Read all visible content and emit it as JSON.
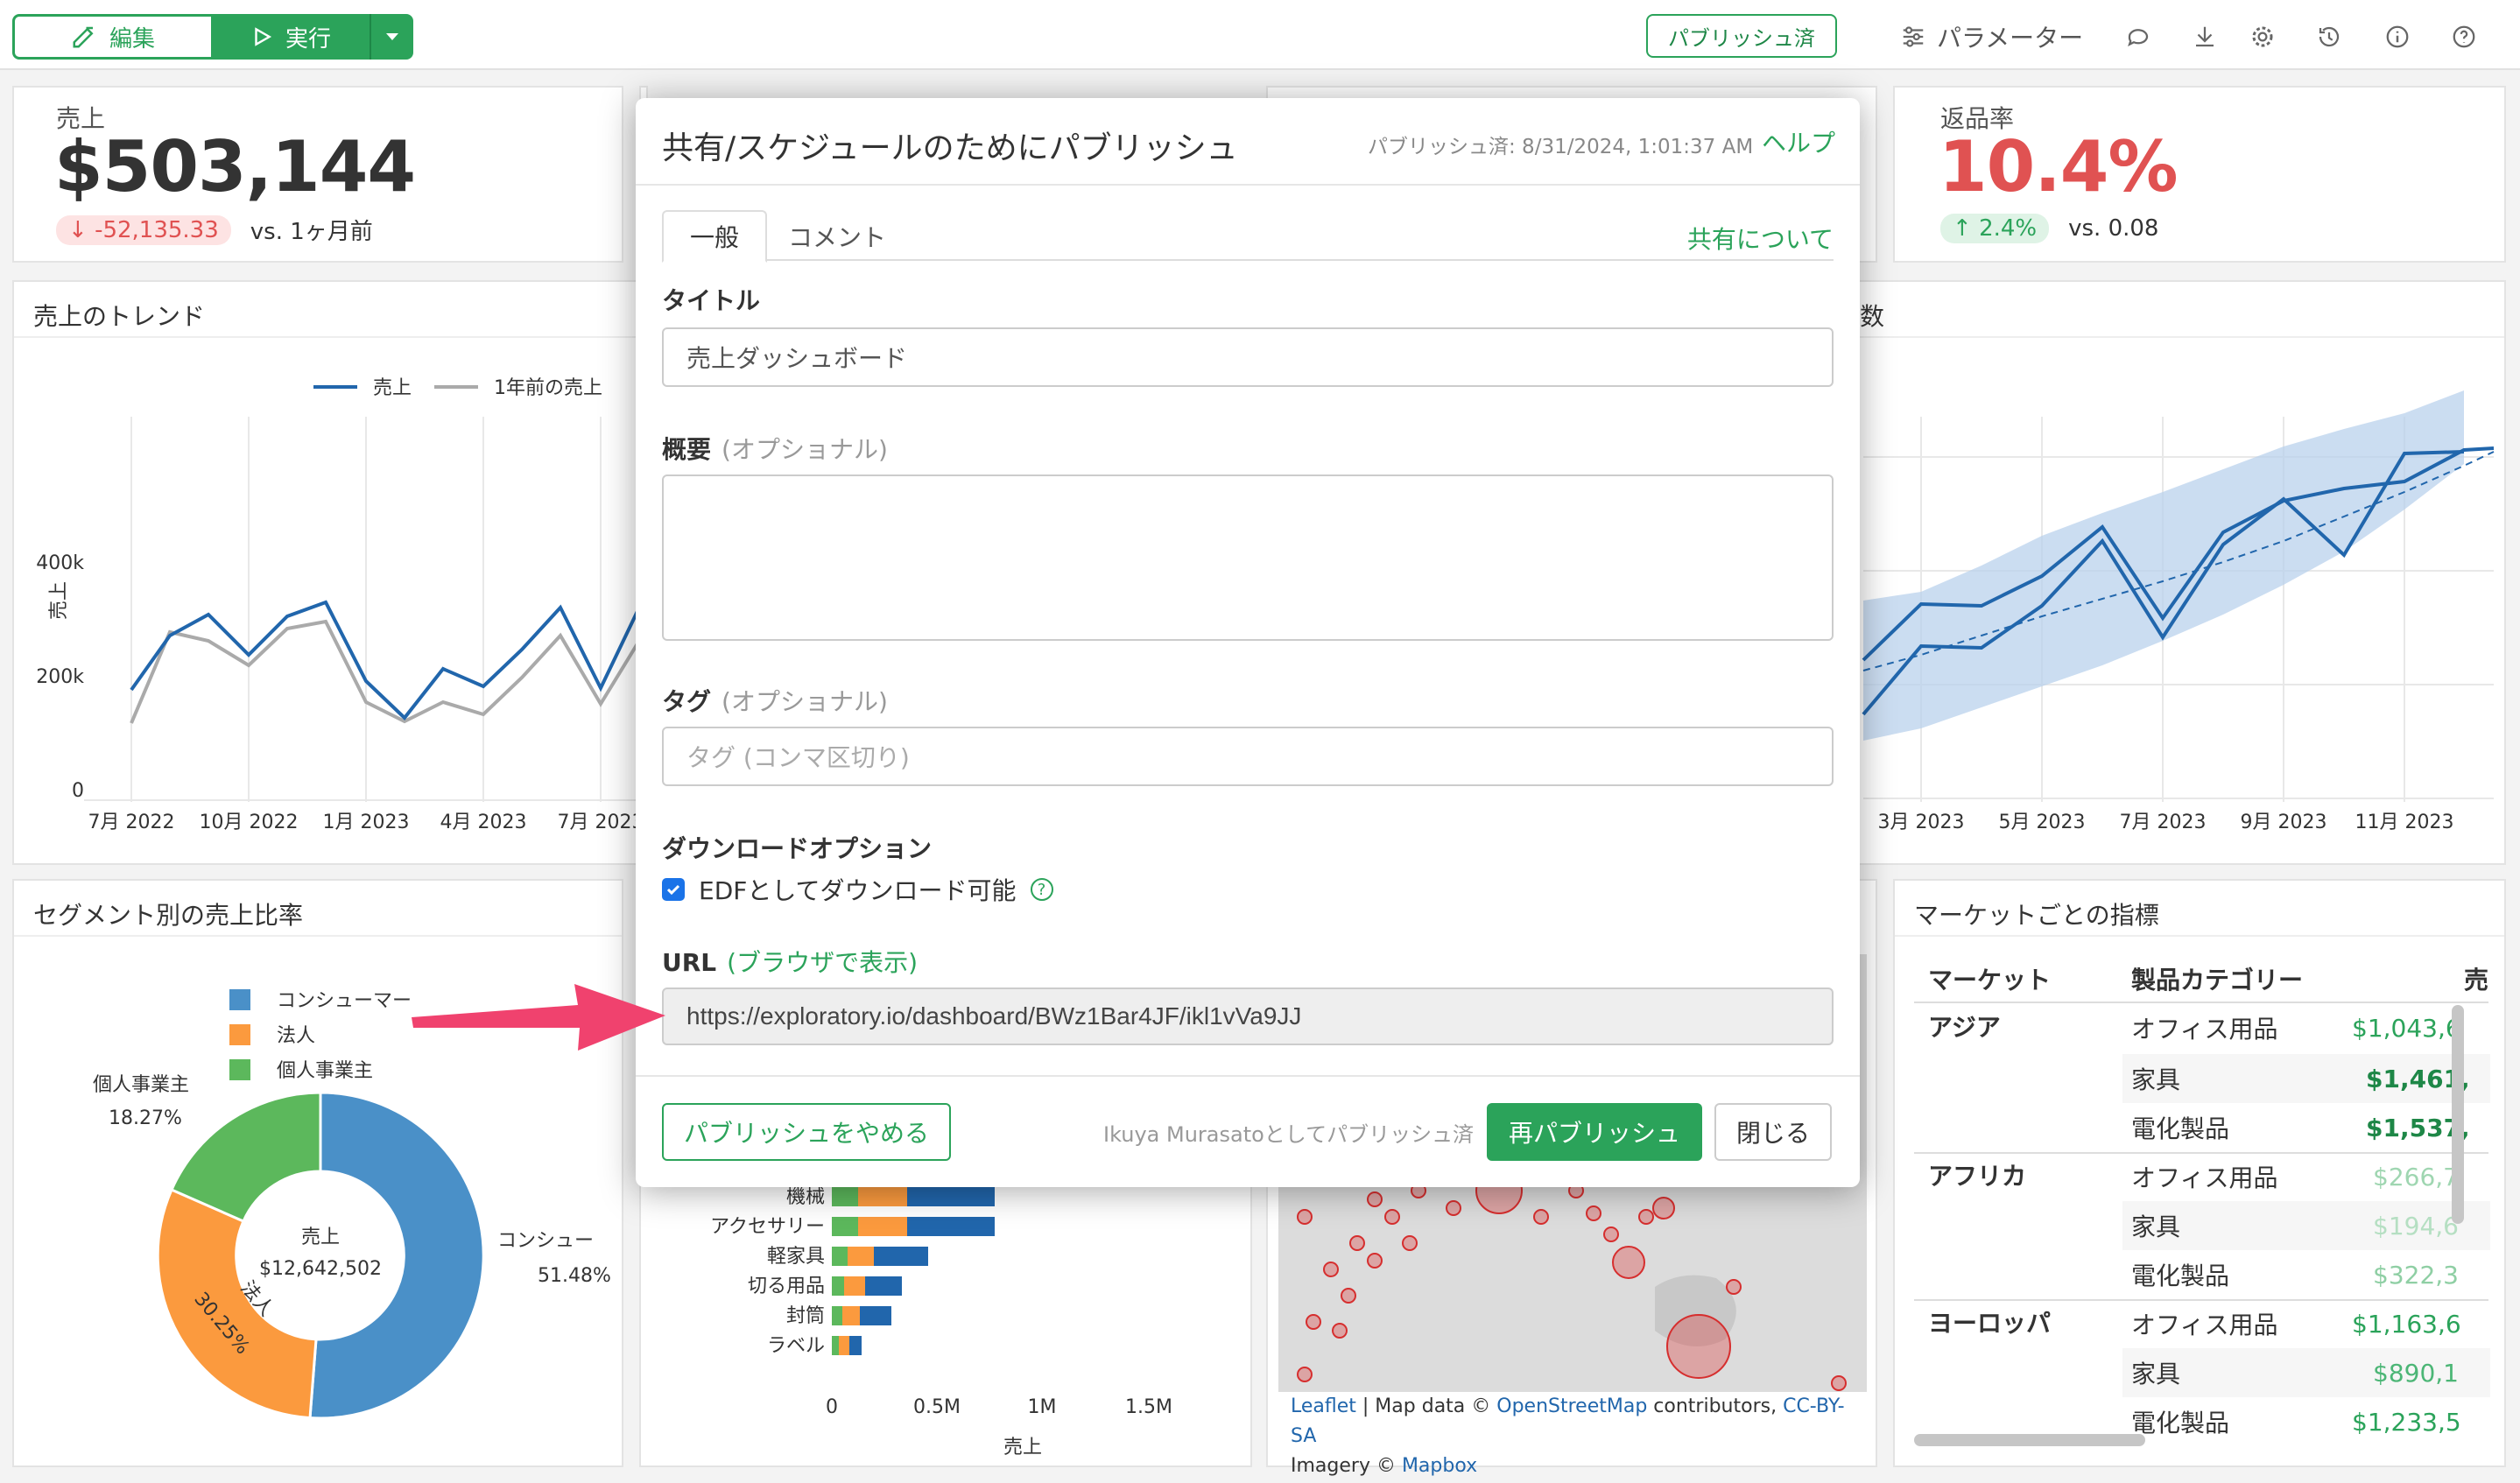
{
  "toolbar": {
    "edit_label": "編集",
    "run_label": "実行",
    "published_label": "パブリッシュ済",
    "parameter_label": "パラメーター"
  },
  "kpi_sales": {
    "label": "売上",
    "value": "$503,144",
    "delta": "-52,135.33",
    "vs": "vs. 1ヶ月前"
  },
  "kpi_return": {
    "label": "返品率",
    "value": "10.4%",
    "delta": "2.4%",
    "vs": "vs. 0.08"
  },
  "trend_card": {
    "title": "売上のトレンド",
    "legend": [
      "売上",
      "1年前の売上"
    ],
    "ylabel": "売上",
    "yticks": [
      "400k",
      "200k",
      "0"
    ],
    "xticks": [
      "7月 2022",
      "10月 2022",
      "1月 2023",
      "4月 2023",
      "7月 2023"
    ]
  },
  "right_trend_card": {
    "title_fragment": "数",
    "xticks": [
      "3月 2023",
      "5月 2023",
      "7月 2023",
      "9月 2023",
      "11月 2023"
    ]
  },
  "segment_card": {
    "title": "セグメント別の売上比率",
    "legend": [
      "コンシューマー",
      "法人",
      "個人事業主"
    ],
    "center_label": "売上",
    "center_value": "$12,642,502",
    "label_left": "個人事業主",
    "label_left_pct": "18.27%",
    "label_right": "コンシュー",
    "label_right_pct": "51.48%",
    "label_mid": "法人",
    "label_mid_pct": "30.25%"
  },
  "bar_card": {
    "categories": [
      "機械",
      "アクセサリー",
      "軽家具",
      "切る用品",
      "封筒",
      "ラベル"
    ],
    "xticks": [
      "0",
      "0.5M",
      "1M",
      "1.5M"
    ],
    "xlabel": "売上"
  },
  "map_card": {
    "attribution_leaflet": "Leaflet",
    "attribution_mapdata": " | Map data © ",
    "attribution_osm": "OpenStreetMap",
    "attribution_contrib": " contributors, ",
    "attribution_cc": "CC-BY-SA",
    "attribution_imagery": "Imagery © ",
    "attribution_mapbox": "Mapbox"
  },
  "market_card": {
    "title": "マーケットごとの指標",
    "headers": [
      "マーケット",
      "製品カテゴリー",
      "売"
    ],
    "groups": [
      {
        "market": "アジア",
        "rows": [
          [
            "オフィス用品",
            "$1,043,6"
          ],
          [
            "家具",
            "$1,461,"
          ],
          [
            "電化製品",
            "$1,537,"
          ]
        ]
      },
      {
        "market": "アフリカ",
        "rows": [
          [
            "オフィス用品",
            "$266,7"
          ],
          [
            "家具",
            "$194,6"
          ],
          [
            "電化製品",
            "$322,3"
          ]
        ]
      },
      {
        "market": "ヨーロッパ",
        "rows": [
          [
            "オフィス用品",
            "$1,163,6"
          ],
          [
            "家具",
            "$890,1"
          ],
          [
            "電化製品",
            "$1,233,5"
          ]
        ]
      }
    ]
  },
  "modal": {
    "title": "共有/スケジュールのためにパブリッシュ",
    "published_at": "パブリッシュ済: 8/31/2024, 1:01:37 AM",
    "help": "ヘルプ",
    "tab_general": "一般",
    "tab_comment": "コメント",
    "about_sharing": "共有について",
    "title_label": "タイトル",
    "title_value": "売上ダッシュボード",
    "summary_label": "概要",
    "optional": "(オプショナル)",
    "tag_label": "タグ",
    "tag_placeholder": "タグ (コンマ区切り)",
    "download_label": "ダウンロードオプション",
    "download_checkbox": "EDFとしてダウンロード可能",
    "url_label": "URL",
    "url_view": "(ブラウザで表示)",
    "url_value": "https://exploratory.io/dashboard/BWz1Bar4JF/ikl1vVa9JJ",
    "unpublish": "パブリッシュをやめる",
    "published_by": "Ikuya Murasatoとしてパブリッシュ済",
    "republish": "再パブリッシュ",
    "close": "閉じる"
  },
  "colors": {
    "accent_green": "#2ba35a",
    "kpi_red": "#e05252",
    "series_blue": "#2166ac",
    "series_gray": "#aaaaaa",
    "consumer_blue": "#4a90c8",
    "corporate_orange": "#fb9a3e",
    "home_office_green": "#5cb85c",
    "arrow_pink": "#f0426e"
  }
}
